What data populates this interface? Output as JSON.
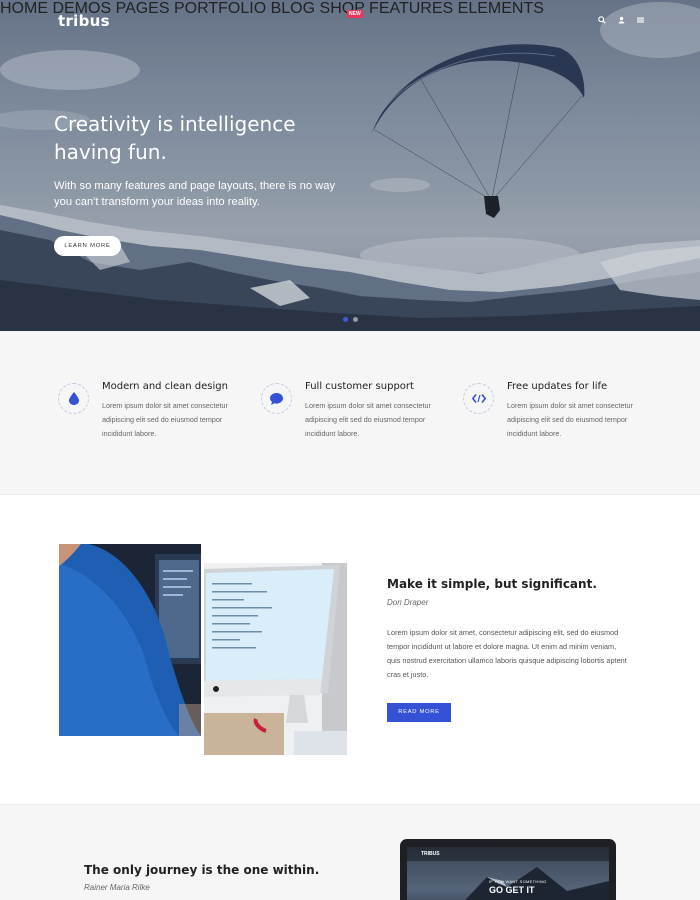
{
  "nav": {
    "logo": "tribus",
    "items": [
      "HOME",
      "DEMOS",
      "PAGES",
      "PORTFOLIO",
      "BLOG",
      "SHOP",
      "FEATURES",
      "ELEMENTS"
    ],
    "badge": "NEW",
    "icons": [
      "search-icon",
      "user-icon",
      "menu-icon"
    ]
  },
  "hero": {
    "title_line1": "Creativity is intelligence",
    "title_line2": "having fun.",
    "subtitle": "With so many features and page layouts, there is no way you can't transform your ideas into reality.",
    "cta": "LEARN MORE",
    "slides": 2,
    "active_slide": 1
  },
  "features": [
    {
      "icon": "drop-icon",
      "title": "Modern and clean design",
      "text": "Lorem ipsum dolor sit amet consectetur adipiscing elit sed do eiusmod tempor incididunt labore."
    },
    {
      "icon": "chat-icon",
      "title": "Full customer support",
      "text": "Lorem ipsum dolor sit amet consectetur adipiscing elit sed do eiusmod tempor incididunt labore."
    },
    {
      "icon": "code-icon",
      "title": "Free updates for life",
      "text": "Lorem ipsum dolor sit amet consectetur adipiscing elit sed do eiusmod tempor incididunt labore."
    }
  ],
  "about": {
    "title": "Make it simple, but significant.",
    "author": "Don Draper",
    "text": "Lorem ipsum dolor sit amet, consectetur adipiscing elit, sed do eiusmod tempor incididunt ut labore et dolore magna. Ut enim ad minim veniam, quis nostrud exercitation ullamco laboris quisque adipiscing lobortis aptent cras et justo.",
    "cta": "READ MORE"
  },
  "quote": {
    "title": "The only journey is the one within.",
    "author": "Rainer Maria Rilke",
    "laptop_logo": "TRIBUS",
    "laptop_text": "IF YOU WANT SOMETHING",
    "laptop_big": "GO GET IT"
  },
  "colors": {
    "accent": "#3551d6",
    "badge": "#e8375b",
    "feature_bg": "#f6f6f7"
  }
}
